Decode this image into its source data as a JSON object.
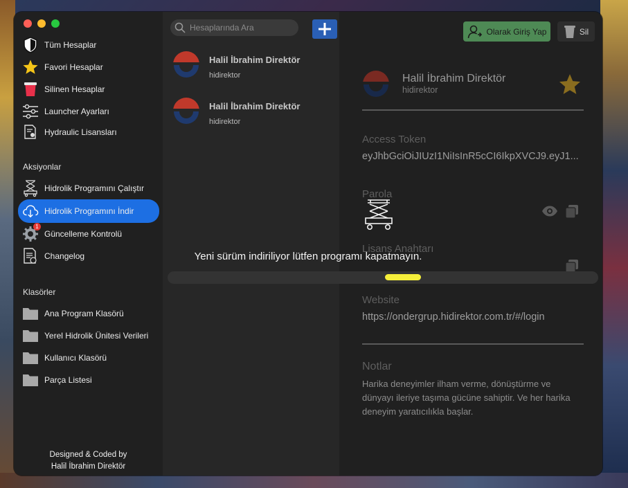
{
  "sidebar": {
    "items": [
      {
        "label": "Tüm Hesaplar",
        "icon": "shield-icon"
      },
      {
        "label": "Favori Hesaplar",
        "icon": "star-icon"
      },
      {
        "label": "Silinen Hesaplar",
        "icon": "trash-icon"
      },
      {
        "label": "Launcher Ayarları",
        "icon": "sliders-icon"
      },
      {
        "label": "Hydraulic Lisansları",
        "icon": "certificate-icon"
      }
    ],
    "actions_title": "Aksiyonlar",
    "actions": [
      {
        "label": "Hidrolik Programını Çalıştır",
        "icon": "scissor-lift-icon"
      },
      {
        "label": "Hidrolik Programını İndir",
        "icon": "cloud-download-icon",
        "active": true
      },
      {
        "label": "Güncelleme Kontrolü",
        "icon": "gear-update-icon",
        "badge": "1"
      },
      {
        "label": "Changelog",
        "icon": "document-list-icon"
      }
    ],
    "folders_title": "Klasörler",
    "folders": [
      {
        "label": "Ana Program Klasörü",
        "icon": "folder-icon"
      },
      {
        "label": "Yerel Hidrolik Ünitesi Verileri",
        "icon": "folder-icon"
      },
      {
        "label": "Kullanıcı Klasörü",
        "icon": "folder-icon"
      },
      {
        "label": "Parça Listesi",
        "icon": "folder-icon"
      }
    ],
    "credit_line1": "Designed & Coded by",
    "credit_line2": "Halil İbrahim Direktör"
  },
  "list": {
    "search_placeholder": "Hesaplarında Ara",
    "add_icon": "plus-icon",
    "accounts": [
      {
        "name": "Halil İbrahim Direktör",
        "username": "hidirektor"
      },
      {
        "name": "Halil İbrahim Direktör",
        "username": "hidirektor"
      }
    ]
  },
  "detail": {
    "login_label": "Olarak Giriş Yap",
    "delete_label": "Sil",
    "name": "Halil İbrahim Direktör",
    "username": "hidirektor",
    "favorite": true,
    "access_token_label": "Access Token",
    "access_token_value": "eyJhbGciOiJIUzI1NiIsInR5cCI6IkpXVCJ9.eyJ1...",
    "password_label": "Parola",
    "license_label": "Lisans Anahtarı",
    "website_label": "Website",
    "website_value": "https://ondergrup.hidirektor.com.tr/#/login",
    "notes_label": "Notlar",
    "notes_value": "Harika deneyimler ilham verme, dönüştürme ve dünyayı ileriye taşıma gücüne sahiptir. Ve her harika deneyim yaratıcılıkla başlar."
  },
  "overlay": {
    "message": "Yeni sürüm indiriliyor lütfen programı kapatmayın.",
    "progress": 0.55
  },
  "colors": {
    "accent": "#1d6fe3",
    "progress": "#f5ef3a",
    "login": "#4e8a55",
    "brand_red": "#c0392b",
    "brand_blue": "#1f3a6e"
  }
}
